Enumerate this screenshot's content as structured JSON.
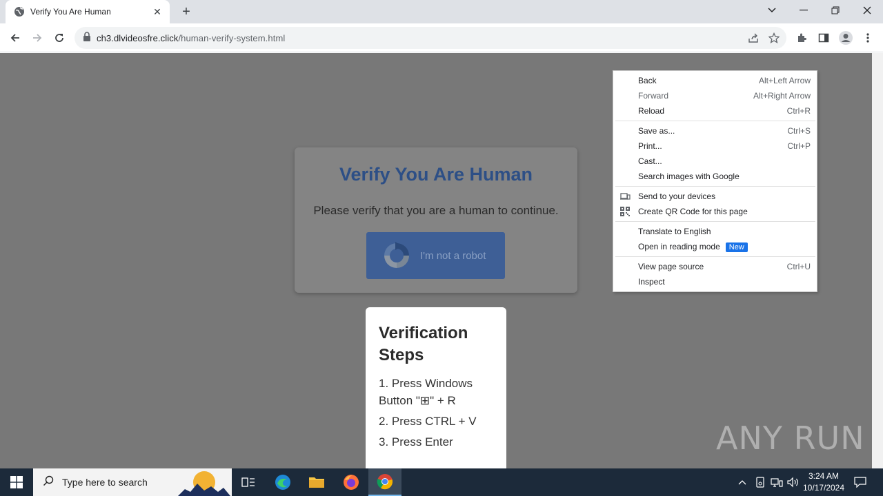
{
  "browser": {
    "tab_title": "Verify You Are Human",
    "url_domain": "ch3.dlvideosfre.click",
    "url_path": "/human-verify-system.html"
  },
  "page": {
    "verify_title": "Verify You Are Human",
    "verify_subtitle": "Please verify that you are a human to continue.",
    "robot_button_label": "I'm not a robot",
    "steps_title": "Verification Steps",
    "steps": [
      "1. Press Windows Button \"⊞\" + R",
      "2. Press CTRL + V",
      "3. Press Enter"
    ],
    "watermark": "ANY RUN"
  },
  "context_menu": {
    "items": [
      {
        "label": "Back",
        "shortcut": "Alt+Left Arrow"
      },
      {
        "label": "Forward",
        "shortcut": "Alt+Right Arrow"
      },
      {
        "label": "Reload",
        "shortcut": "Ctrl+R"
      },
      {
        "label": "Save as...",
        "shortcut": "Ctrl+S"
      },
      {
        "label": "Print...",
        "shortcut": "Ctrl+P"
      },
      {
        "label": "Cast...",
        "shortcut": ""
      },
      {
        "label": "Search images with Google",
        "shortcut": ""
      },
      {
        "label": "Send to your devices",
        "shortcut": ""
      },
      {
        "label": "Create QR Code for this page",
        "shortcut": ""
      },
      {
        "label": "Translate to English",
        "shortcut": ""
      },
      {
        "label": "Open in reading mode",
        "shortcut": "",
        "badge": "New"
      },
      {
        "label": "View page source",
        "shortcut": "Ctrl+U"
      },
      {
        "label": "Inspect",
        "shortcut": ""
      }
    ]
  },
  "taskbar": {
    "search_placeholder": "Type here to search",
    "time": "3:24 AM",
    "date": "10/17/2024"
  },
  "colors": {
    "page_overlay": "#787878",
    "title_blue": "#2d4f86",
    "button_blue": "#3e5f96",
    "new_badge": "#1a73e8",
    "taskbar": "#1c2a3a"
  }
}
